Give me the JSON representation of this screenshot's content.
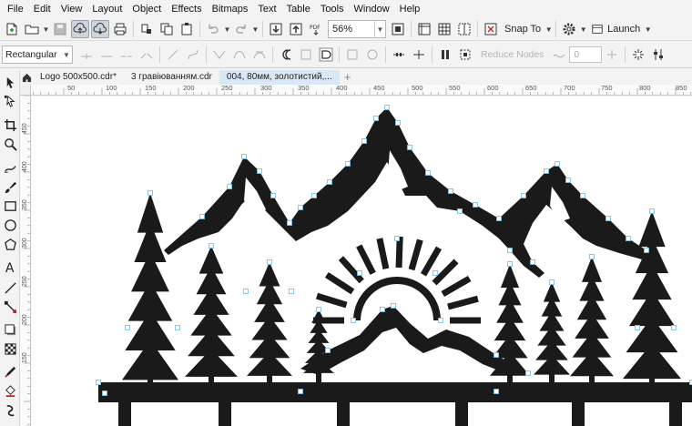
{
  "menu": [
    "File",
    "Edit",
    "View",
    "Layout",
    "Object",
    "Effects",
    "Bitmaps",
    "Text",
    "Table",
    "Tools",
    "Window",
    "Help"
  ],
  "toolbar": {
    "zoom_value": "56%",
    "snap_label": "Snap To",
    "launch_label": "Launch"
  },
  "propertybar": {
    "shape_mode": "Rectangular",
    "reduce_nodes_label": "Reduce Nodes",
    "curve_smoothness_value": "0"
  },
  "tabs": [
    "Logo 500x500.cdr*",
    "3 гравіюванням.cdr",
    "004, 80мм, золотистий,..."
  ],
  "ruler": {
    "h_ticks": [
      "50",
      "100",
      "150",
      "200",
      "250",
      "300",
      "350",
      "400",
      "450",
      "500",
      "550",
      "600",
      "650",
      "700",
      "750",
      "800",
      "850"
    ],
    "v_ticks": [
      "450",
      "400",
      "350",
      "300",
      "250",
      "200",
      "150"
    ]
  },
  "colors": {
    "artwork": "#1a1a1a",
    "node": "#7cc3e6",
    "active_tab": "#d9e7f7"
  }
}
